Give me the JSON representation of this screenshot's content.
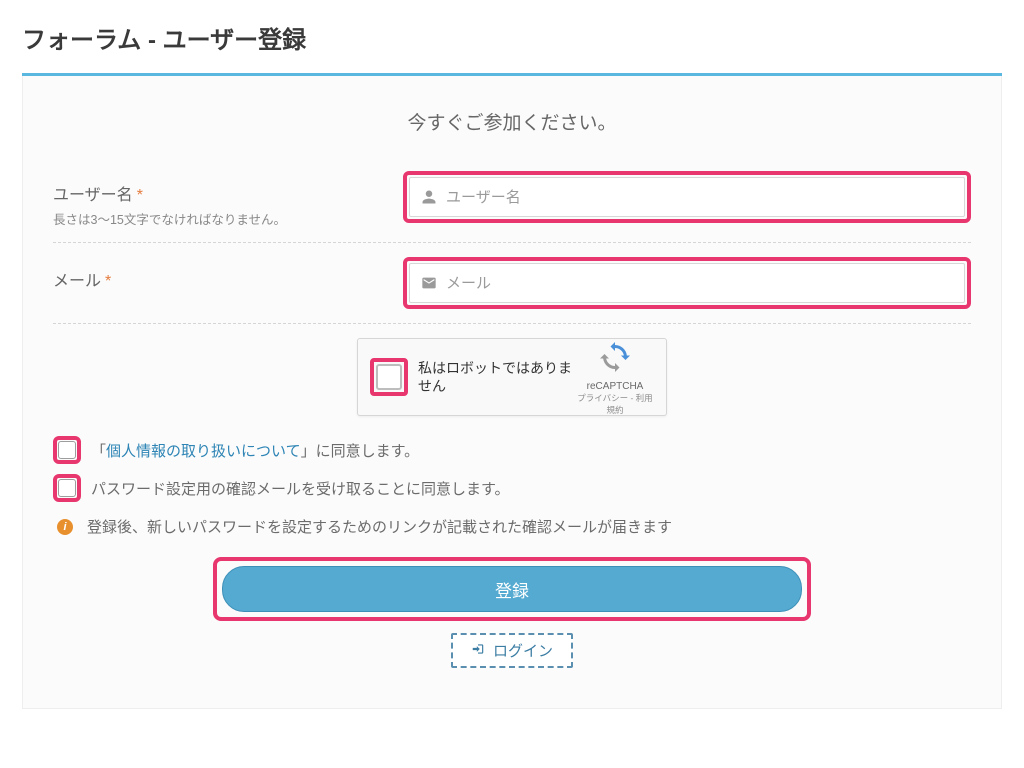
{
  "page_title": "フォーラム - ユーザー登録",
  "subtitle": "今すぐご参加ください。",
  "fields": {
    "username": {
      "label": "ユーザー名",
      "hint": "長さは3〜15文字でなければなりません。",
      "placeholder": "ユーザー名"
    },
    "email": {
      "label": "メール",
      "placeholder": "メール"
    }
  },
  "required_mark": "*",
  "captcha": {
    "label": "私はロボットではありません",
    "brand": "reCAPTCHA",
    "legal": "プライバシー - 利用規約"
  },
  "consents": {
    "privacy_prefix": "「",
    "privacy_link": "個人情報の取り扱いについて",
    "privacy_suffix": "」に同意します。",
    "password_mail": "パスワード設定用の確認メールを受け取ることに同意します。"
  },
  "info_note": "登録後、新しいパスワードを設定するためのリンクが記載された確認メールが届きます",
  "submit_label": "登録",
  "login_label": "ログイン",
  "colors": {
    "accent": "#59b7e0",
    "highlight": "#e8366f"
  }
}
